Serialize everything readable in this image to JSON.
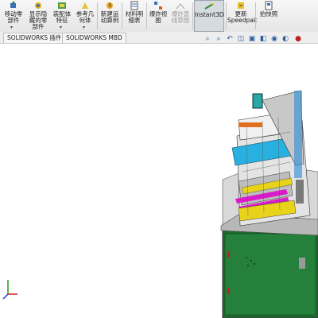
{
  "ribbon": {
    "buttons": [
      {
        "label": "移动零\n部件",
        "icon": "move-component-icon"
      },
      {
        "label": "显示隐\n藏的零\n部件",
        "icon": "show-hidden-icon"
      },
      {
        "label": "装配体\n特征",
        "icon": "assembly-feature-icon"
      },
      {
        "label": "参考几\n何体",
        "icon": "reference-geometry-icon"
      },
      {
        "label": "新建运\n动算例",
        "icon": "motion-study-icon"
      },
      {
        "label": "材料明\n细表",
        "icon": "bom-icon"
      },
      {
        "label": "爆炸视\n图",
        "icon": "exploded-view-icon"
      },
      {
        "label": "爆炸直\n线草图",
        "icon": "explode-line-sketch-icon"
      },
      {
        "label": "Instant3D",
        "icon": "instant3d-icon"
      },
      {
        "label": "更新\nSpeedpak",
        "icon": "speedpak-icon"
      },
      {
        "label": "拍快照",
        "icon": "snapshot-icon"
      }
    ]
  },
  "tabs": [
    "SOLIDWORKS 插件",
    "SOLIDWORKS MBD"
  ],
  "view_toolbar": [
    "zoom-to-fit-icon",
    "zoom-area-icon",
    "previous-view-icon",
    "section-view-icon",
    "view-orientation-icon",
    "display-style-icon",
    "hide-show-icon",
    "edit-appearance-icon",
    "scene-icon"
  ],
  "colors": {
    "ribbon_bg": "#ececec",
    "cabinet_green": "#1f6b2e",
    "frame_gray": "#cfcfcf",
    "accent_cyan": "#28b0e0",
    "accent_magenta": "#d81cc8",
    "accent_yellow": "#e8d21a"
  }
}
